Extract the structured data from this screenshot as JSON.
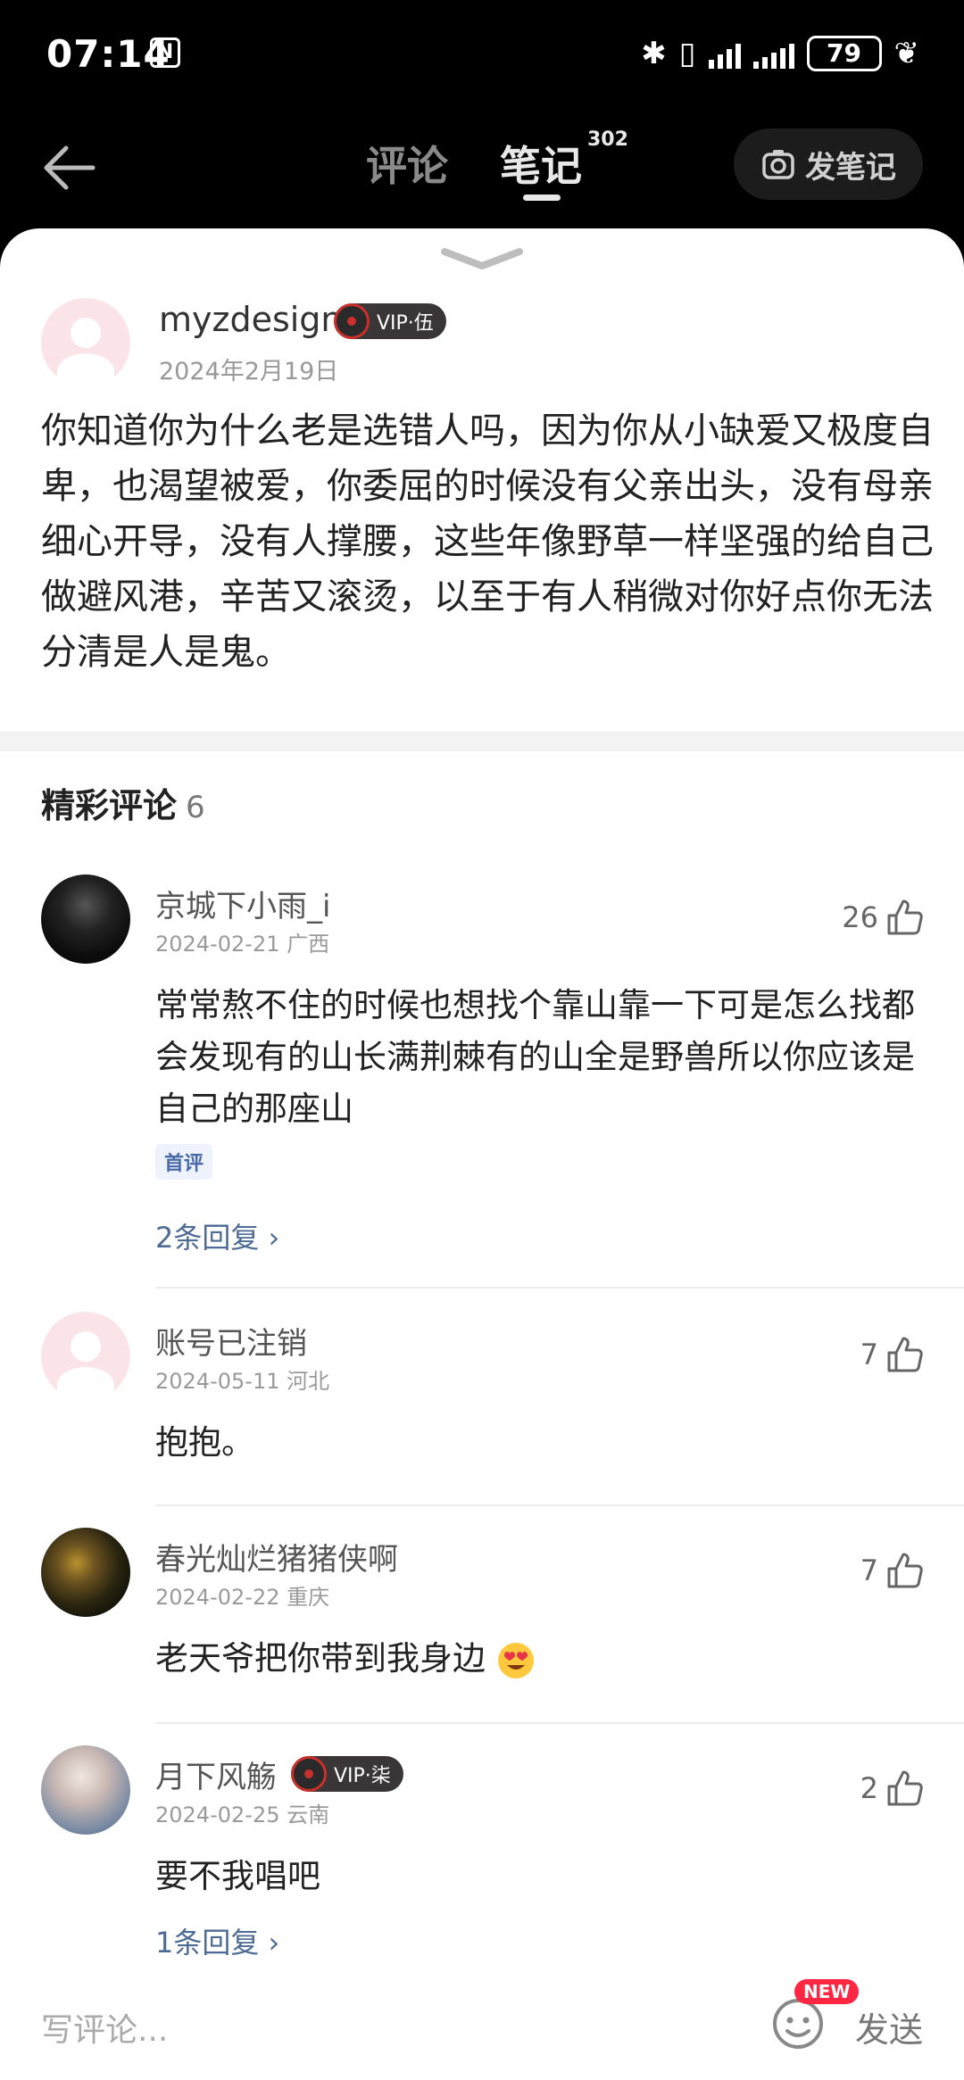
{
  "status_bar": {
    "time": "07:14",
    "nfc": "N",
    "battery": "79"
  },
  "nav": {
    "tabs": [
      {
        "label": "评论"
      },
      {
        "label": "笔记",
        "count": "302"
      }
    ],
    "post_button": "发笔记"
  },
  "post": {
    "author": "myzdesign",
    "vip_label": "VIP·伍",
    "date": "2024年2月19日",
    "text": "你知道你为什么老是选错人吗，因为你从小缺爱又极度自卑，也渴望被爱，你委屈的时候没有父亲出头，没有母亲细心开导，没有人撑腰，这些年像野草一样坚强的给自己做避风港，辛苦又滚烫，以至于有人稍微对你好点你无法分清是人是鬼。"
  },
  "comments_section": {
    "title": "精彩评论",
    "count": "6"
  },
  "comments": [
    {
      "name": "京城下小雨_i",
      "date": "2024-02-21",
      "location": "广西",
      "likes": "26",
      "text": "常常熬不住的时候也想找个靠山靠一下可是怎么找都会发现有的山长满荆棘有的山全是野兽所以你应该是自己的那座山",
      "badge": "首评",
      "replies": "2条回复"
    },
    {
      "name": "账号已注销",
      "date": "2024-05-11",
      "location": "河北",
      "likes": "7",
      "text": "抱抱。"
    },
    {
      "name": "春光灿烂猪猪侠啊",
      "date": "2024-02-22",
      "location": "重庆",
      "likes": "7",
      "text": "老天爷把你带到我身边"
    },
    {
      "name": "月下风觞",
      "vip_label": "VIP·柒",
      "date": "2024-02-25",
      "location": "云南",
      "likes": "2",
      "text": "要不我唱吧",
      "replies": "1条回复"
    }
  ],
  "bottom_bar": {
    "placeholder": "写评论...",
    "new_badge": "NEW",
    "send": "发送"
  },
  "colors": {
    "accent_link": "#4d6b94",
    "vip_disc": "#c9302c",
    "new_badge": "#ff2741"
  }
}
